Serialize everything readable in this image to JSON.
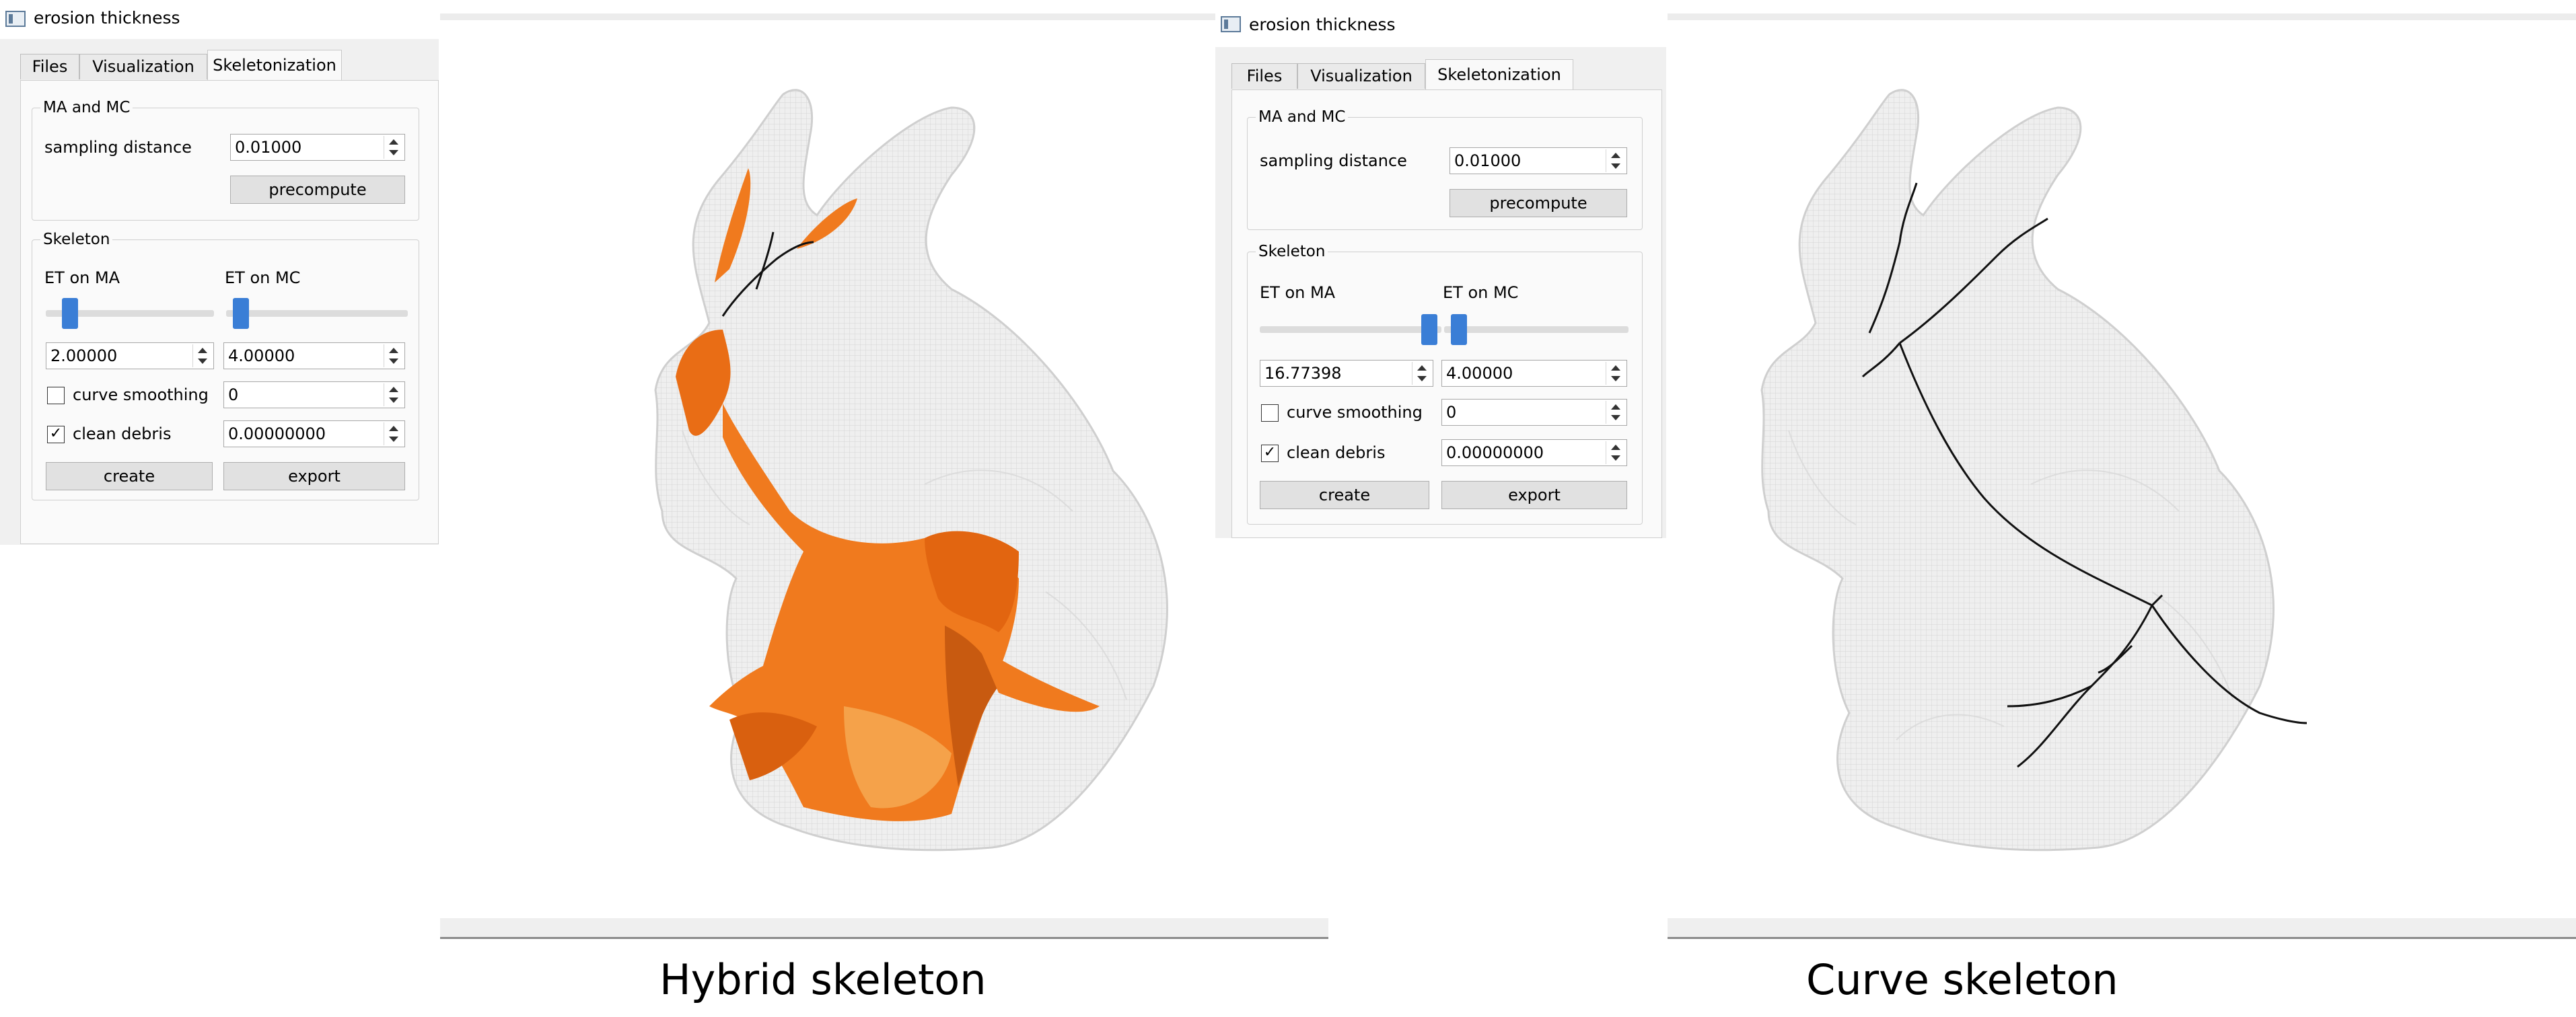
{
  "left_panel": {
    "window_title": "erosion thickness",
    "tabs": [
      "Files",
      "Visualization",
      "Skeletonization"
    ],
    "active_tab": "Skeletonization",
    "ma_mc_group": "MA and MC",
    "sampling_label": "sampling distance",
    "sampling_value": "0.01000",
    "precompute_label": "precompute",
    "skeleton_group": "Skeleton",
    "et_ma_label": "ET on MA",
    "et_mc_label": "ET on MC",
    "et_ma_value": "2.00000",
    "et_mc_value": "4.00000",
    "slider_ma_fraction": 0.15,
    "slider_mc_fraction": 0.09,
    "curve_smoothing_label": "curve smoothing",
    "curve_smoothing_checked": false,
    "curve_smoothing_value": "0",
    "clean_debris_label": "clean debris",
    "clean_debris_checked": true,
    "clean_debris_value": "0.00000000",
    "create_label": "create",
    "export_label": "export"
  },
  "right_panel": {
    "window_title": "erosion thickness",
    "tabs": [
      "Files",
      "Visualization",
      "Skeletonization"
    ],
    "active_tab": "Skeletonization",
    "ma_mc_group": "MA and MC",
    "sampling_label": "sampling distance",
    "sampling_value": "0.01000",
    "precompute_label": "precompute",
    "skeleton_group": "Skeleton",
    "et_ma_label": "ET on MA",
    "et_mc_label": "ET on MC",
    "et_ma_value": "16.77398",
    "et_mc_value": "4.00000",
    "slider_ma_fraction": 0.96,
    "slider_mc_fraction": 0.09,
    "curve_smoothing_label": "curve smoothing",
    "curve_smoothing_checked": false,
    "curve_smoothing_value": "0",
    "clean_debris_label": "clean debris",
    "clean_debris_checked": true,
    "clean_debris_value": "0.00000000",
    "create_label": "create",
    "export_label": "export"
  },
  "captions": {
    "hybrid": "Hybrid skeleton",
    "curve": "Curve skeleton"
  },
  "colors": {
    "skeleton_surface": "#f07a1e",
    "skeleton_surface_dark": "#c85a10",
    "curve_line": "#111111",
    "bunny_voxels": "#e2e2e2",
    "slider_handle": "#3a7ed6"
  }
}
